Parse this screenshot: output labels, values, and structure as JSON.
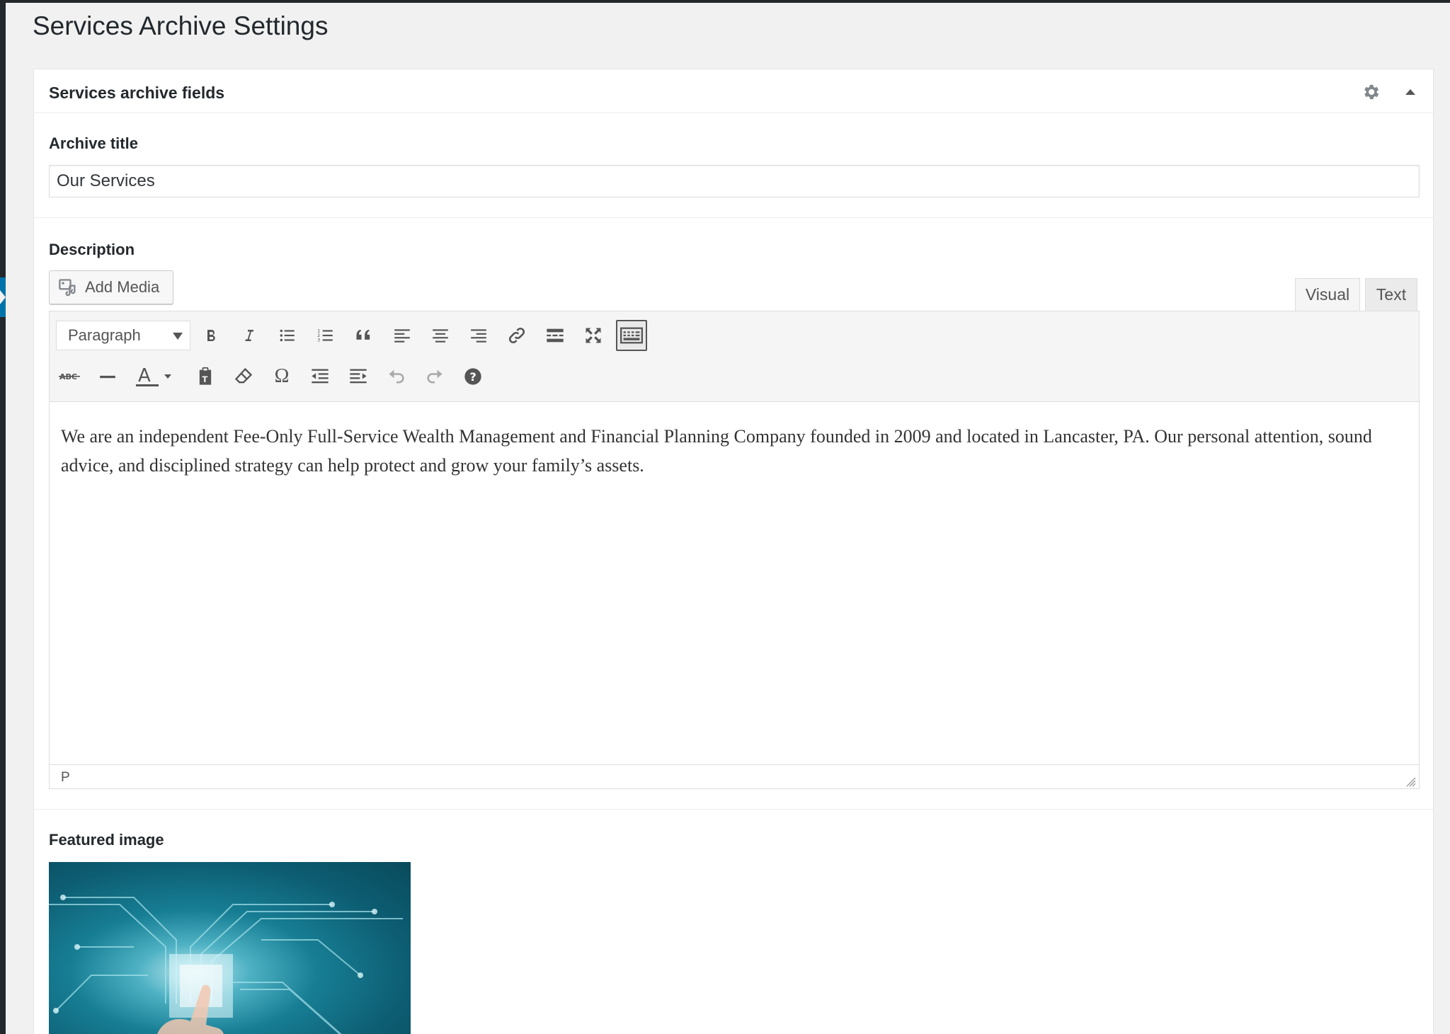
{
  "page": {
    "title": "Services Archive Settings"
  },
  "metabox": {
    "title": "Services archive fields",
    "archive_title_label": "Archive title",
    "archive_title_value": "Our Services",
    "description_label": "Description",
    "featured_image_label": "Featured image"
  },
  "editor": {
    "add_media_label": "Add Media",
    "tab_visual": "Visual",
    "tab_text": "Text",
    "format_select": "Paragraph",
    "content": "We are an independent Fee-Only Full-Service Wealth Management and Financial Planning Company founded in 2009 and located in Lancaster, PA. Our personal attention, sound advice, and disciplined strategy can help protect and grow your family’s assets.",
    "status_path": "P",
    "toolbar_row1": [
      "bold",
      "italic",
      "bullet-list",
      "numbered-list",
      "blockquote",
      "align-left",
      "align-center",
      "align-right",
      "link",
      "read-more",
      "fullscreen",
      "toolbar-toggle"
    ],
    "toolbar_row2": [
      "strikethrough",
      "horizontal-line",
      "text-color",
      "paste-as-text",
      "clear-formatting",
      "special-character",
      "outdent",
      "indent",
      "undo",
      "redo",
      "keyboard-shortcuts"
    ]
  }
}
